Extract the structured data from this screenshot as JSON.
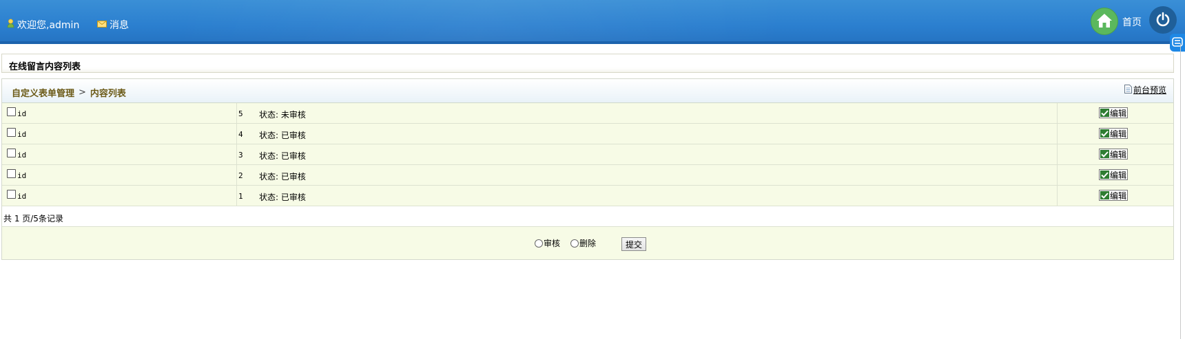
{
  "header": {
    "welcome": "欢迎您,admin",
    "messages": "消息",
    "home": "首页"
  },
  "page": {
    "title": "在线留言内容列表"
  },
  "breadcrumb": {
    "parent": "自定义表单管理",
    "separator": ">",
    "current": "内容列表",
    "preview": "前台预览"
  },
  "table": {
    "rows": [
      {
        "label": "id",
        "num": "5",
        "status": "状态: 未审核",
        "action": "编辑"
      },
      {
        "label": "id",
        "num": "4",
        "status": "状态: 已审核",
        "action": "编辑"
      },
      {
        "label": "id",
        "num": "3",
        "status": "状态: 已审核",
        "action": "编辑"
      },
      {
        "label": "id",
        "num": "2",
        "status": "状态: 已审核",
        "action": "编辑"
      },
      {
        "label": "id",
        "num": "1",
        "status": "状态: 已审核",
        "action": "编辑"
      }
    ]
  },
  "pagination": {
    "text": "共 1 页/5条记录"
  },
  "actions": {
    "approve": "审核",
    "delete": "删除",
    "submit": "提交"
  },
  "icons": {
    "user": "user-icon",
    "mail": "mail-icon",
    "home": "home-icon",
    "power": "power-icon",
    "document": "document-icon",
    "check": "check-icon",
    "side_tab": "sidebar-toggle-icon"
  },
  "colors": {
    "header_blue": "#2b7fcf",
    "row_bg": "#f7fbe6",
    "breadcrumb_text": "#6b5a17",
    "home_green": "#5bb85d"
  }
}
